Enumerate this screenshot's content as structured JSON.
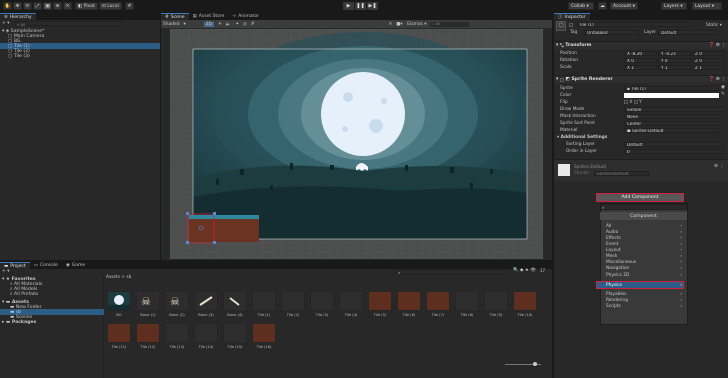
{
  "toolbar": {
    "account_initial": "J",
    "cloud_icon": "cloud-icon",
    "pivot_label": "Pivot",
    "local_label": "Local",
    "collab_label": "Collab ▾",
    "account_label": "Account ▾",
    "layers_label": "Layers ▾",
    "layout_label": "Layout ▾"
  },
  "hierarchy": {
    "tab_label": "Hierarchy",
    "add_label": "+ ▾",
    "search_placeholder": "All",
    "scene_name": "SampleScene*",
    "items": [
      "Main Camera",
      "BG",
      "Tile (1)",
      "Tile (2)",
      "Tile (3)"
    ]
  },
  "scene": {
    "tabs": [
      "Scene",
      "Asset Store",
      "Animator"
    ],
    "shading_mode": "Shaded",
    "two_d_label": "2D",
    "gizmos_label": "Gizmos ▾",
    "search_placeholder": "All"
  },
  "inspector": {
    "tab_label": "Inspector",
    "object_name": "Tile (1)",
    "static_label": "Static ▾",
    "tag_label": "Tag",
    "tag_value": "Untagged",
    "layer_label": "Layer",
    "layer_value": "Default",
    "transform": {
      "title": "Transform",
      "rows": [
        {
          "label": "Position",
          "x": "-8.20",
          "y": "-4.23",
          "z": "0"
        },
        {
          "label": "Rotation",
          "x": "0",
          "y": "0",
          "z": "0"
        },
        {
          "label": "Scale",
          "x": "1",
          "y": "1",
          "z": "1"
        }
      ]
    },
    "sprite_renderer": {
      "title": "Sprite Renderer",
      "sprite_label": "Sprite",
      "sprite_value": "Tile (1)",
      "color_label": "Color",
      "flip_label": "Flip",
      "flip_x": "X",
      "flip_y": "Y",
      "draw_mode_label": "Draw Mode",
      "draw_mode_value": "Simple",
      "mask_label": "Mask Interaction",
      "mask_value": "None",
      "sort_point_label": "Sprite Sort Point",
      "sort_point_value": "Center",
      "material_label": "Material",
      "material_value": "Sprites-Default",
      "additional_label": "Additional Settings",
      "sorting_layer_label": "Sorting Layer",
      "sorting_layer_value": "Default",
      "order_label": "Order in Layer",
      "order_value": "0"
    },
    "material": {
      "name": "Sprites-Default",
      "shader_label": "Shader",
      "shader_value": "Sprites/Default"
    },
    "add_component_label": "Add Component",
    "component_popup": {
      "title": "Component",
      "items": [
        "Audio",
        "Effects",
        "Event",
        "Layout",
        "Mesh",
        "Miscellaneous",
        "Navigation",
        "Physics 2D",
        "Physics",
        "Playables",
        "Rendering",
        "Scripts"
      ],
      "first_item": "All",
      "selected_index": 7
    }
  },
  "project": {
    "tabs": [
      "Project",
      "Console",
      "Game"
    ],
    "add_label": "+ ▾",
    "breadcrumb_root": "Assets",
    "breadcrumb_sep": ">",
    "breadcrumb_folder": "sb",
    "hidden_count": "17",
    "favorites_title": "Favorites",
    "favorites": [
      "All Materials",
      "All Models",
      "All Prefabs"
    ],
    "assets_title": "Assets",
    "asset_folders": [
      "New Folder",
      "sb",
      "Scenes"
    ],
    "packages_title": "Packages",
    "assets_row1": [
      "BG",
      "Bone (1)",
      "Bone (2)",
      "Bone (3)",
      "Bone (4)",
      "Tile (1)",
      "Tile (2)",
      "Tile (3)",
      "Tile (4)",
      "Tile (5)",
      "Tile (6)",
      "Tile (7)",
      "Tile (8)",
      "Tile (9)",
      "Tile (10)"
    ],
    "assets_row2": [
      "Tile (11)",
      "Tile (12)",
      "Tile (13)",
      "Tile (14)",
      "Tile (15)",
      "Tile (16)"
    ]
  },
  "colors": {
    "accent": "#3a79bb",
    "selection": "#2c5d87",
    "highlight_red": "#d0203a",
    "moon": "#e8f2ff",
    "sky_dark": "#1a3a3e"
  }
}
